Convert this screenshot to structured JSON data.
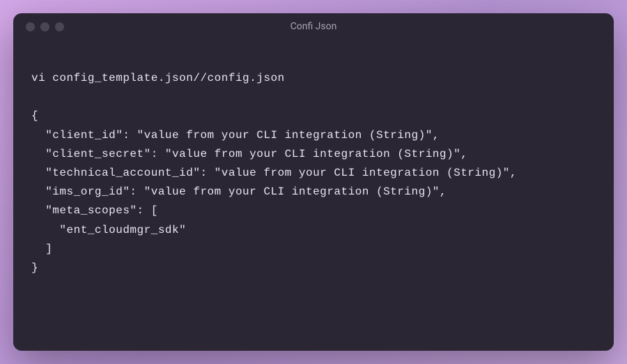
{
  "window": {
    "title": "Confi Json"
  },
  "code": {
    "lines": [
      "vi config_template.json//config.json",
      "",
      "{",
      "  \"client_id\": \"value from your CLI integration (String)\",",
      "  \"client_secret\": \"value from your CLI integration (String)\",",
      "  \"technical_account_id\": \"value from your CLI integration (String)\",",
      "  \"ims_org_id\": \"value from your CLI integration (String)\",",
      "  \"meta_scopes\": [",
      "    \"ent_cloudmgr_sdk\"",
      "  ]",
      "}"
    ]
  }
}
